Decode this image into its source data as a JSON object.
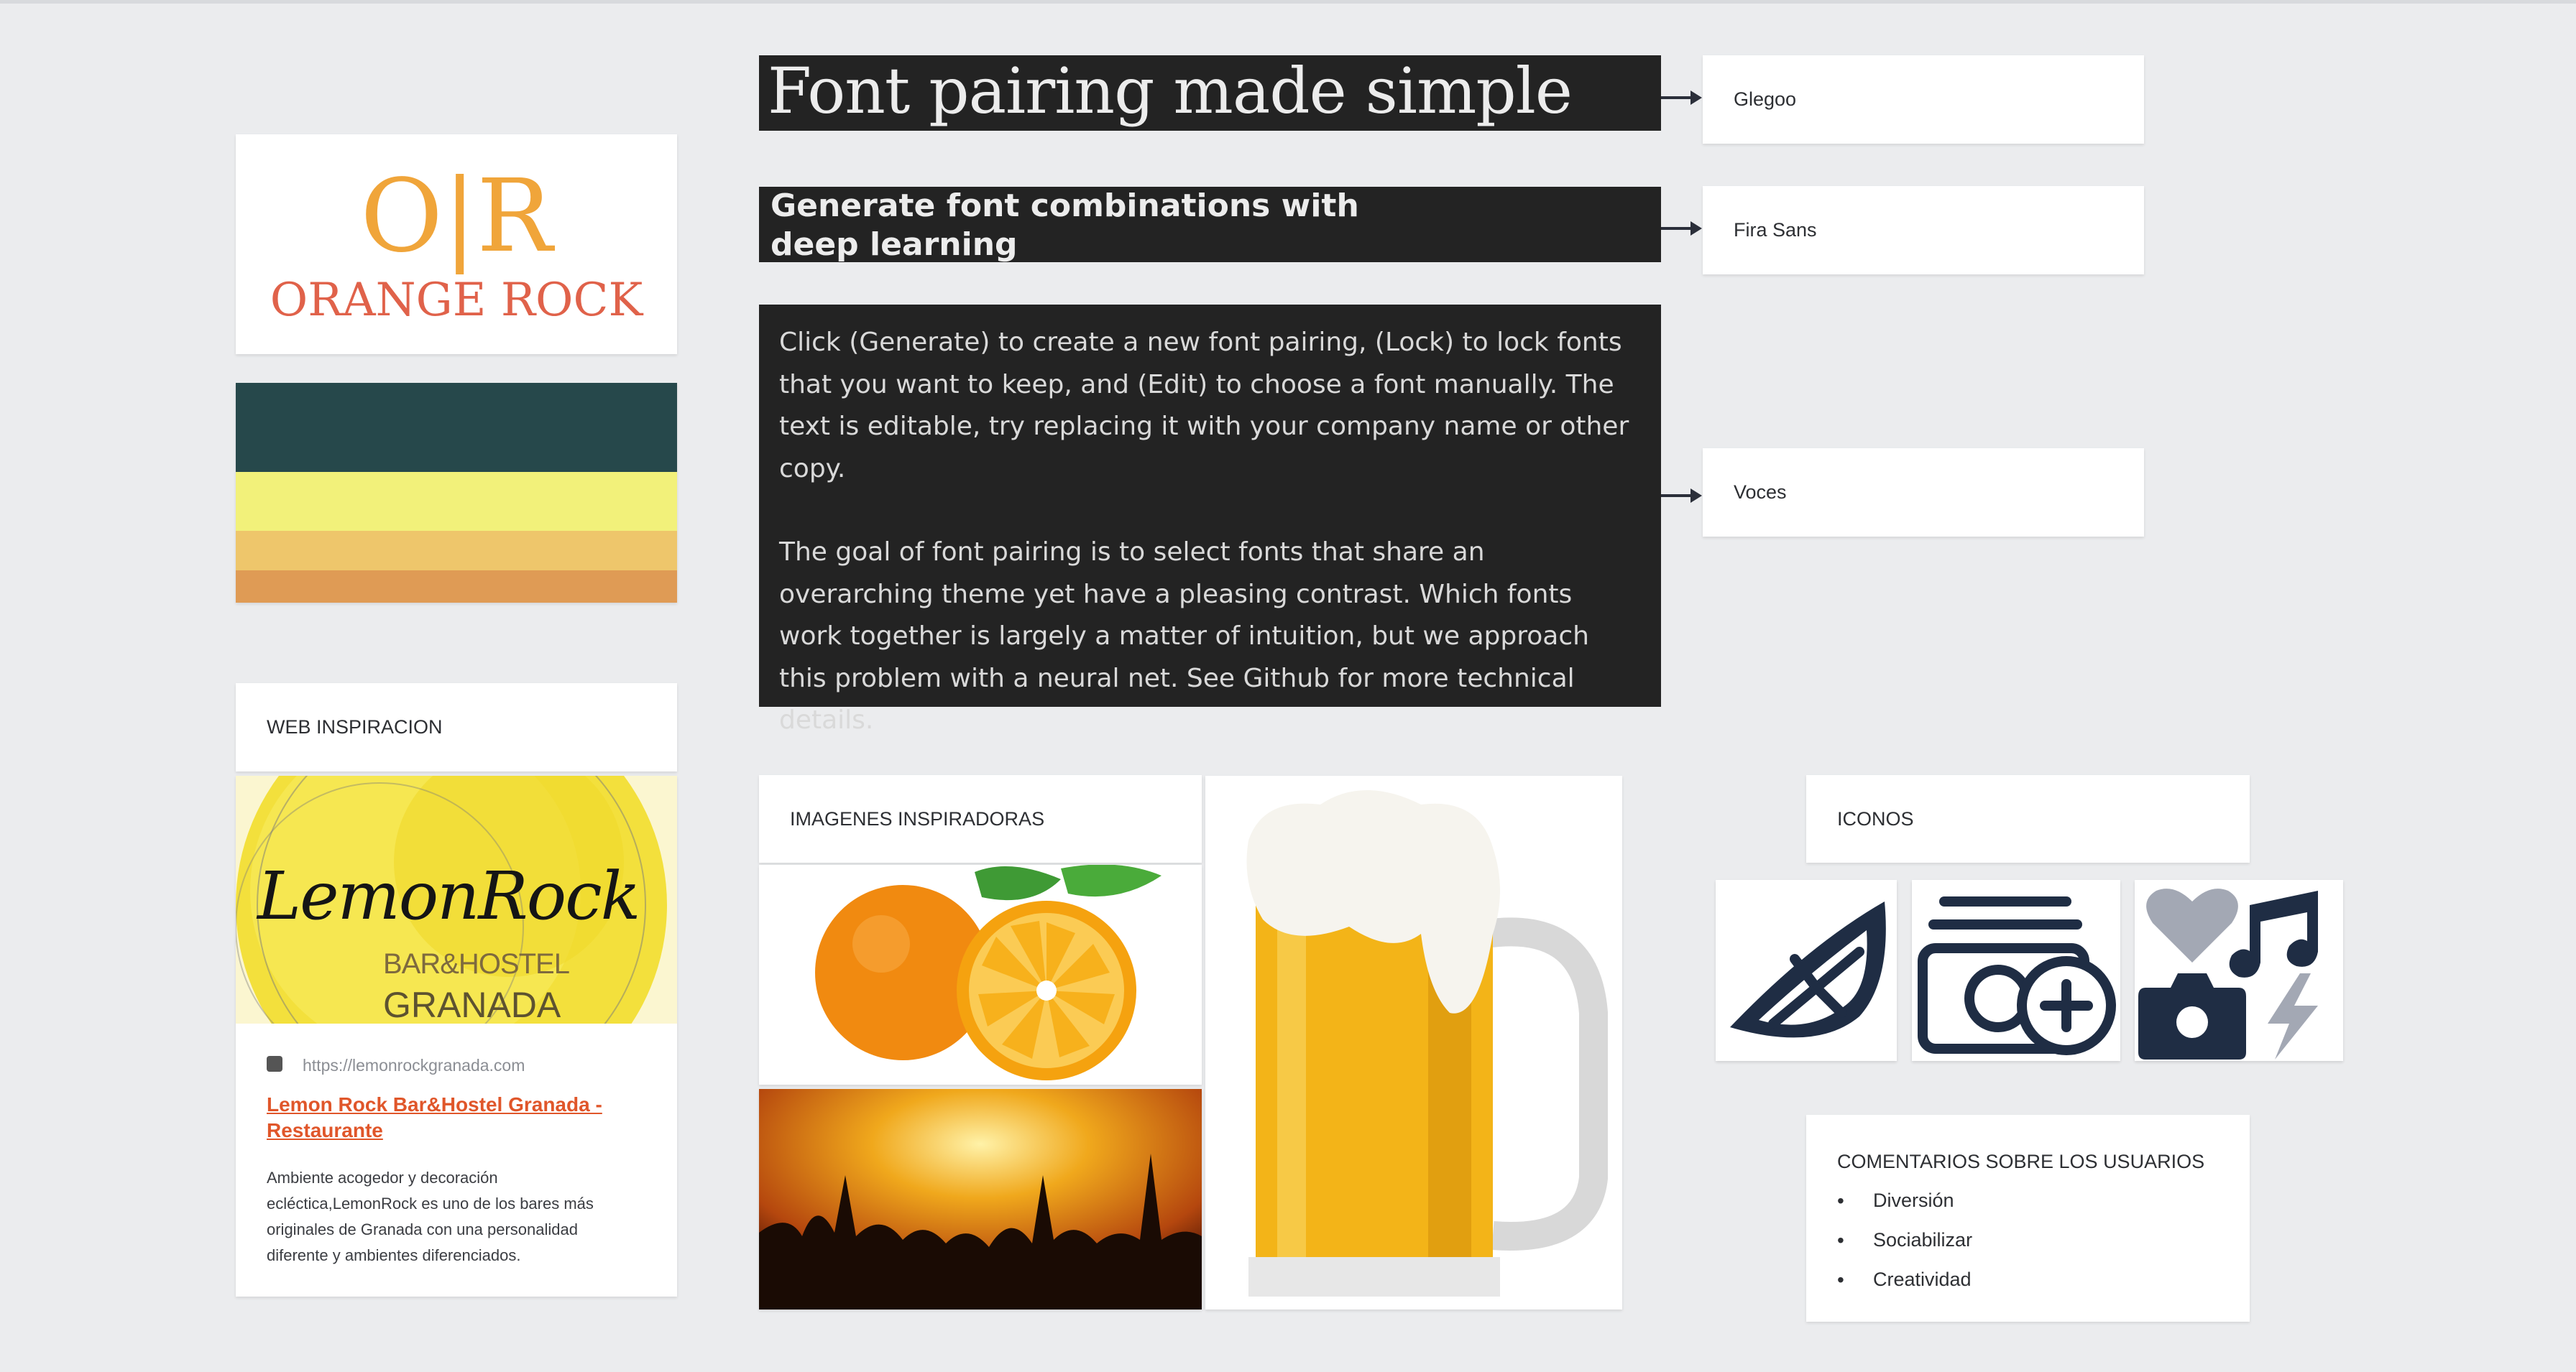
{
  "fonts": {
    "heading_text": "Font pairing made simple",
    "heading_font": "Glegoo",
    "subheading_text": "Generate font combinations with deep learning",
    "subheading_font": "Fira Sans",
    "body_paragraph_1": "Click (Generate) to create a new font pairing, (Lock) to lock fonts that you want to keep, and (Edit) to choose a font manually. The text is editable, try replacing it with your company name or other copy.",
    "body_paragraph_2": "The goal of font pairing is to select fonts that share an overarching theme yet have a pleasing contrast. Which fonts work together is largely a matter of intuition, but we approach this problem with a neural net. See Github for more technical details.",
    "body_font": "Voces"
  },
  "logo": {
    "monogram": "O|R",
    "name": "ORANGE ROCK",
    "colors": {
      "monogram": "#f0a53a",
      "name": "#e0624a"
    }
  },
  "palette": {
    "colors": [
      "#26484b",
      "#f2f17a",
      "#eec66b",
      "#df9b55"
    ]
  },
  "web_inspiration": {
    "title": "WEB INSPIRACION",
    "image_text_1": "LemonRock",
    "image_text_2": "BAR&HOSTEL",
    "image_text_3": "GRANADA",
    "url": "https://lemonrockgranada.com",
    "link_text": "Lemon Rock Bar&Hostel Granada - Restaurante",
    "description": "Ambiente acogedor y decoración ecléctica,LemonRock es uno de los bares más originales de Granada con una personalidad diferente y ambientes diferenciados.",
    "link_color": "#e0562a"
  },
  "images": {
    "title": "IMAGENES INSPIRADORAS",
    "items": [
      "orange-photo",
      "concert-photo",
      "beer-mug-photo"
    ]
  },
  "icons": {
    "title": "ICONOS",
    "items": [
      "orange-slice-icon",
      "film-add-icon",
      "heart-music-camera-bolt-icon"
    ],
    "color": "#1f2d44"
  },
  "comments": {
    "title": "COMENTARIOS SOBRE LOS USUARIOS",
    "items": [
      "Diversión",
      "Sociabilizar",
      "Creatividad"
    ]
  }
}
